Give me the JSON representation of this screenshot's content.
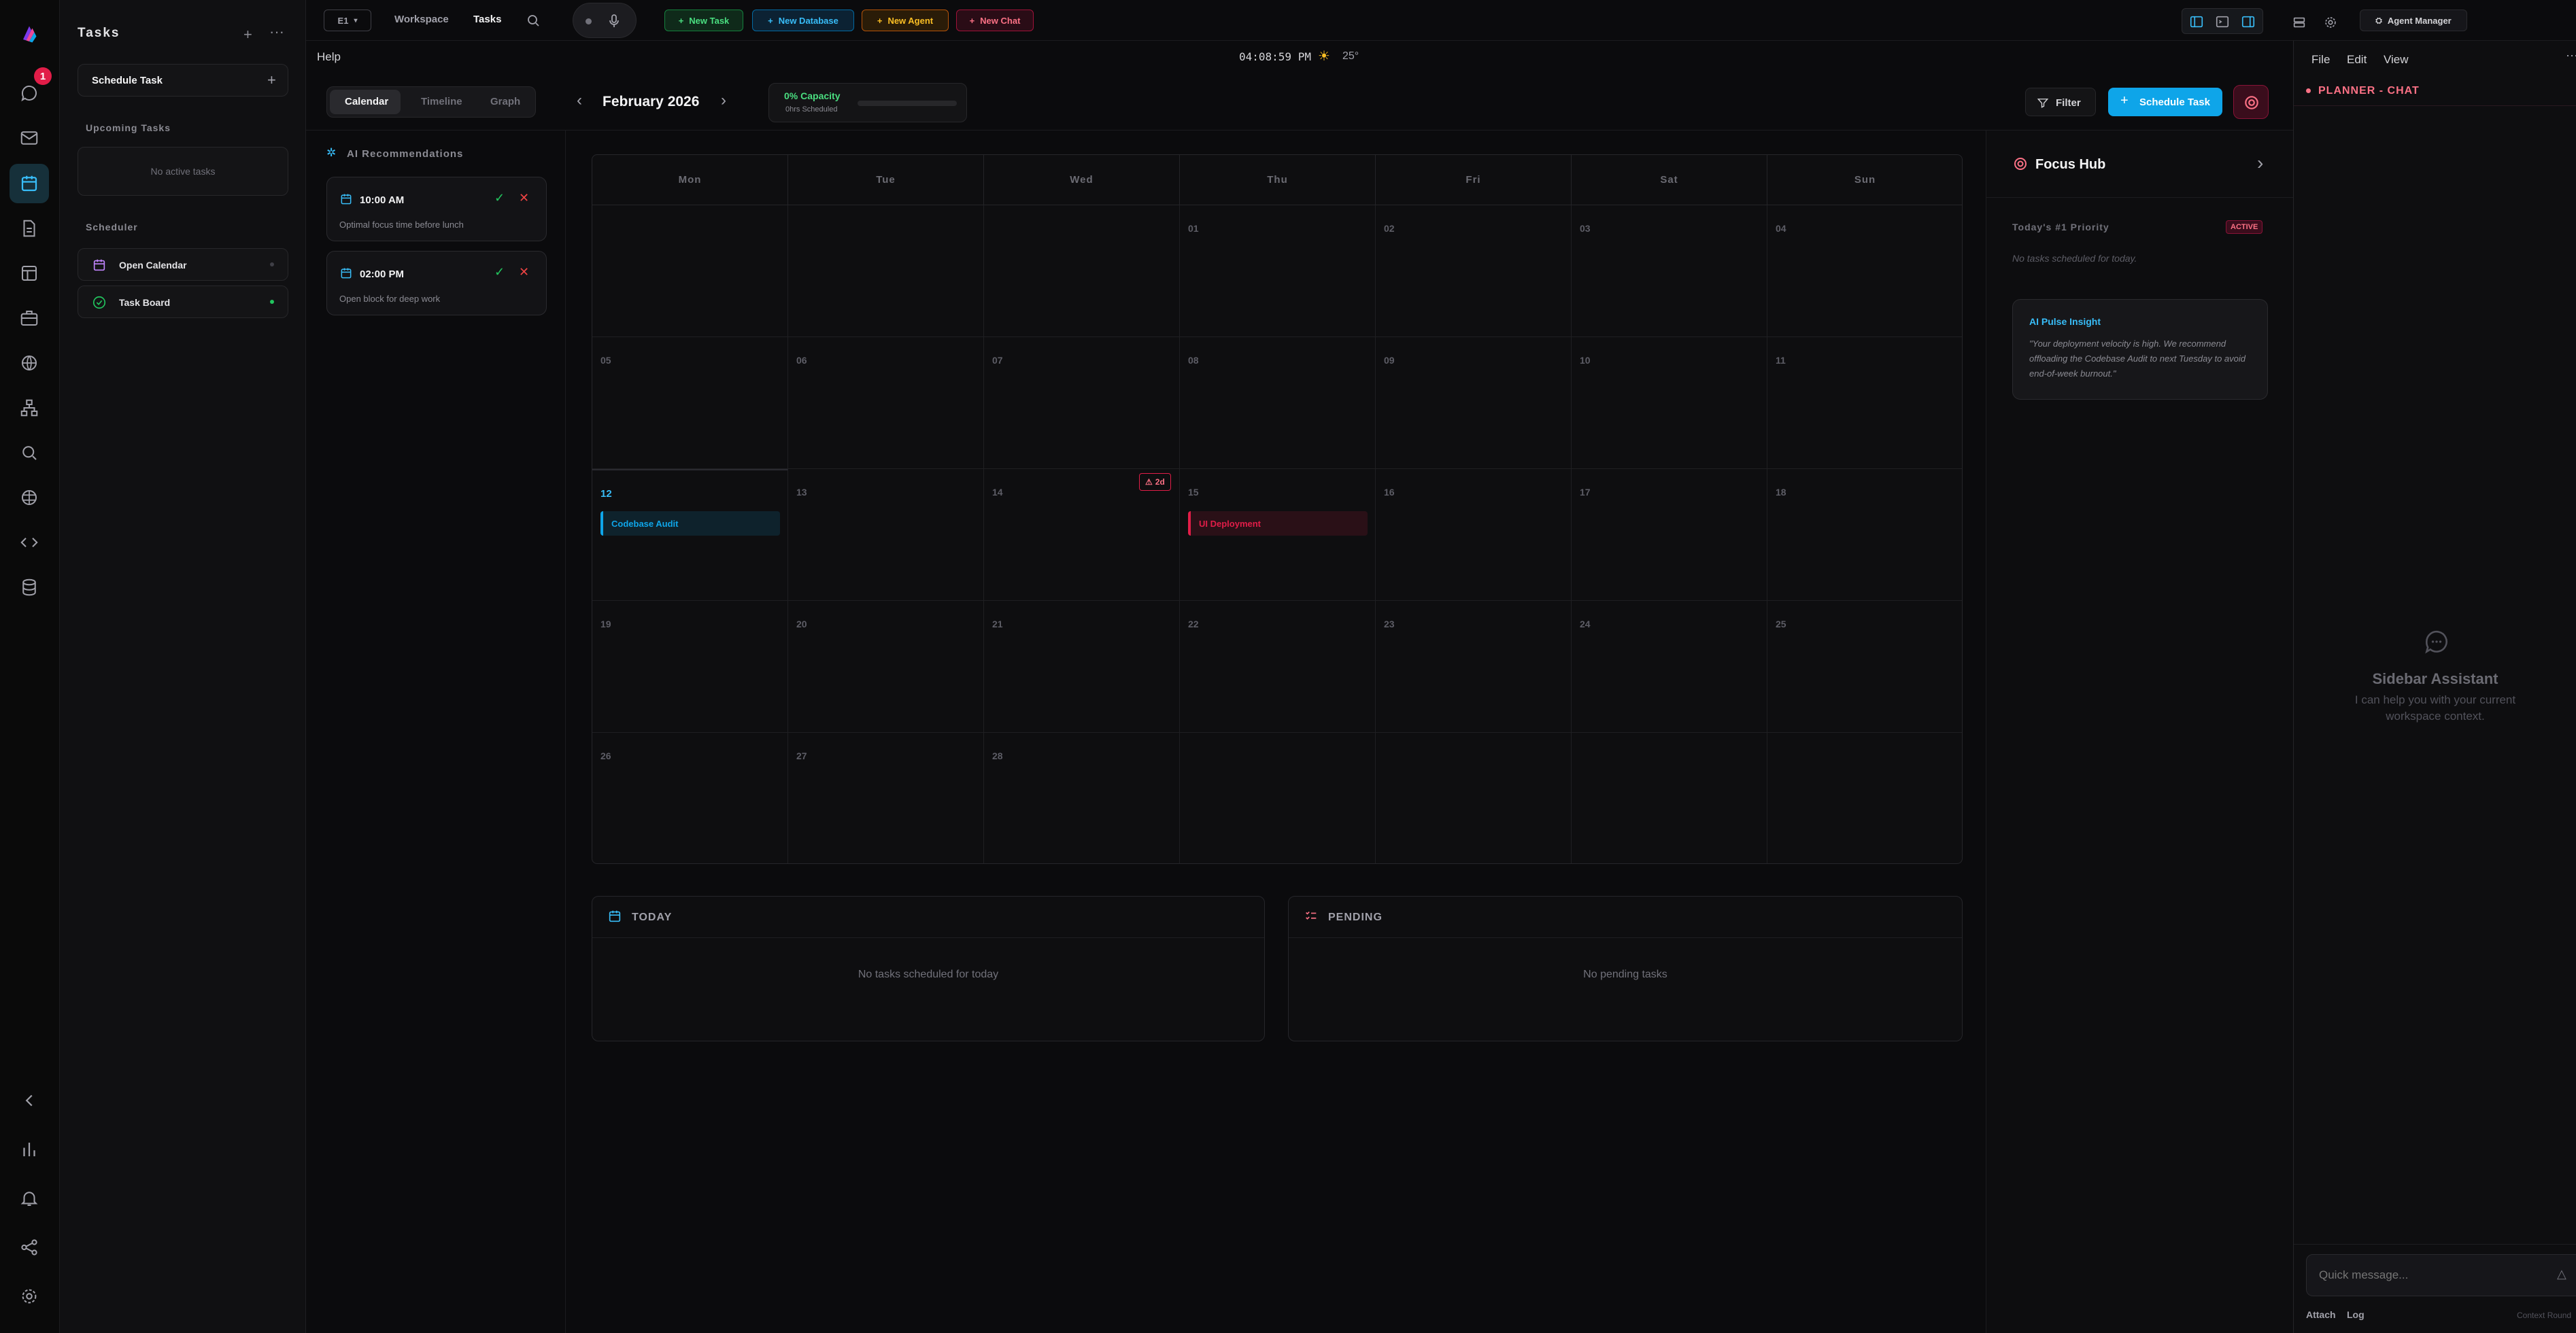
{
  "rail": {
    "notification_count": "1"
  },
  "tasks_panel": {
    "title": "Tasks",
    "schedule_label": "Schedule Task",
    "upcoming_label": "Upcoming Tasks",
    "no_active": "No active tasks",
    "scheduler_label": "Scheduler",
    "items": [
      {
        "label": "Open Calendar"
      },
      {
        "label": "Task Board"
      }
    ]
  },
  "topbar": {
    "workspace_selector": "E1",
    "nav": [
      "Workspace",
      "Tasks"
    ],
    "new_task": "New Task",
    "new_database": "New Database",
    "new_agent": "New Agent",
    "new_chat": "New Chat",
    "agent_manager": "Agent Manager"
  },
  "subbar": {
    "help": "Help",
    "clock": "04:08:59 PM",
    "weather": "25°"
  },
  "toolbar": {
    "tabs": [
      "Calendar",
      "Timeline",
      "Graph"
    ],
    "month": "February 2026",
    "capacity": "0% Capacity",
    "scheduled": "0hrs Scheduled",
    "capacity_fraction": 0,
    "filter": "Filter",
    "schedule_button": "Schedule Task"
  },
  "ai": {
    "title": "AI Recommendations",
    "recommendations": [
      {
        "time": "10:00 AM",
        "desc": "Optimal focus time before lunch"
      },
      {
        "time": "02:00 PM",
        "desc": "Open block for deep work"
      }
    ]
  },
  "calendar": {
    "weekdays": [
      "Mon",
      "Tue",
      "Wed",
      "Thu",
      "Fri",
      "Sat",
      "Sun"
    ],
    "weeks": [
      [
        "",
        "",
        "",
        "01",
        "02",
        "03",
        "04"
      ],
      [
        "05",
        "06",
        "07",
        "08",
        "09",
        "10",
        "11"
      ],
      [
        "12",
        "13",
        "14",
        "15",
        "16",
        "17",
        "18"
      ],
      [
        "19",
        "20",
        "21",
        "22",
        "23",
        "24",
        "25"
      ],
      [
        "26",
        "27",
        "28",
        "",
        "",
        "",
        ""
      ]
    ],
    "today_week": 2,
    "today_day": 0,
    "events": [
      {
        "label": "Codebase Audit",
        "week": 2,
        "day": 0,
        "color": "#0ea5e9"
      },
      {
        "label": "UI Deployment",
        "week": 2,
        "day": 3,
        "color": "#e11d48"
      }
    ],
    "deadline_badge": "2d"
  },
  "today_card": {
    "title": "TODAY",
    "empty": "No tasks scheduled for today"
  },
  "pending_card": {
    "title": "PENDING",
    "empty": "No pending tasks"
  },
  "focus_hub": {
    "title": "Focus Hub",
    "priority_label": "Today's #1 Priority",
    "active_badge": "ACTIVE",
    "priority_empty": "No tasks scheduled for today.",
    "insight_title": "AI Pulse Insight",
    "insight_text": "\"Your deployment velocity is high. We recommend offloading the Codebase Audit to next Tuesday to avoid end-of-week burnout.\""
  },
  "chat": {
    "menu": [
      "File",
      "Edit",
      "View"
    ],
    "header": "PLANNER - CHAT",
    "assistant_title": "Sidebar Assistant",
    "assistant_sub": "I can help you with your current workspace context.",
    "placeholder": "Quick message...",
    "attach": "Attach",
    "log": "Log",
    "context": "Context Round"
  },
  "colors": {
    "accent_blue": "#0ea5e9",
    "accent_pink": "#e11d48",
    "accent_green": "#22c55e",
    "accent_orange": "#f59e0b"
  }
}
